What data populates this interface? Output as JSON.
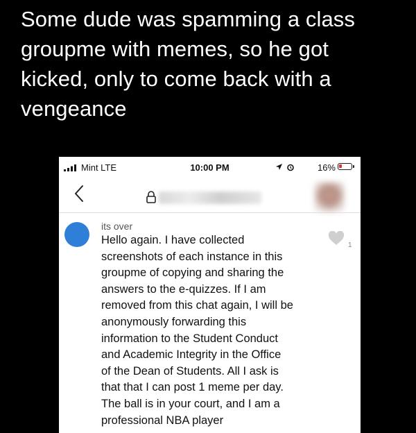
{
  "caption": "Some dude was spamming a class groupme with memes, so he got kicked, only to come back with a vengeance",
  "status_bar": {
    "carrier": "Mint  LTE",
    "time": "10:00 PM",
    "battery": "16%"
  },
  "message": {
    "sender": "its over",
    "lines": [
      "Hello again. I have collected",
      "screenshots of each instance in this",
      "groupme of copying and sharing the",
      "answers to the e-quizzes. If I am",
      "removed from this chat again, I will be",
      "anonymously forwarding this",
      "information to the Student Conduct",
      "and Academic Integrity in the Office",
      "of the Dean of Students. All I ask is",
      "that that I can post 1 meme per day.",
      "The ball is in your court, and I am a",
      "professional NBA player"
    ],
    "like_count": "1"
  },
  "colors": {
    "avatar": "#2f7ed8",
    "battery_low": "#e03030"
  },
  "icons": [
    "signal-icon",
    "location-arrow-icon",
    "alarm-icon",
    "battery-icon",
    "back-chevron-icon",
    "lock-icon",
    "heart-icon"
  ]
}
